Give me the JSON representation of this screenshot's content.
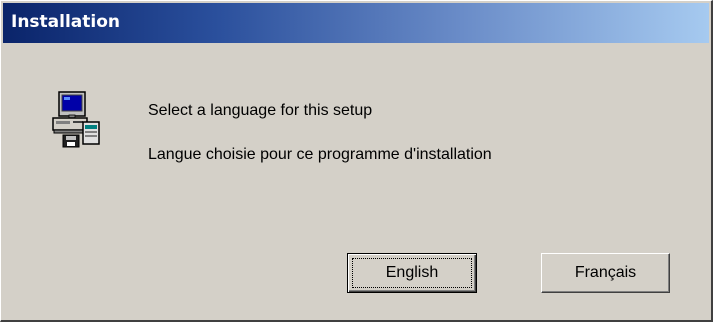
{
  "window": {
    "title": "Installation"
  },
  "dialog": {
    "icon": "computer-setup-icon",
    "message_en": "Select a language for this setup",
    "message_fr": "Langue choisie pour ce programme d'installation"
  },
  "buttons": {
    "english_label": "English",
    "francais_label": "Français",
    "default": "English"
  },
  "colors": {
    "face": "#d4d0c8",
    "title_active_start": "#0a246a",
    "title_active_end": "#a6caf0"
  }
}
